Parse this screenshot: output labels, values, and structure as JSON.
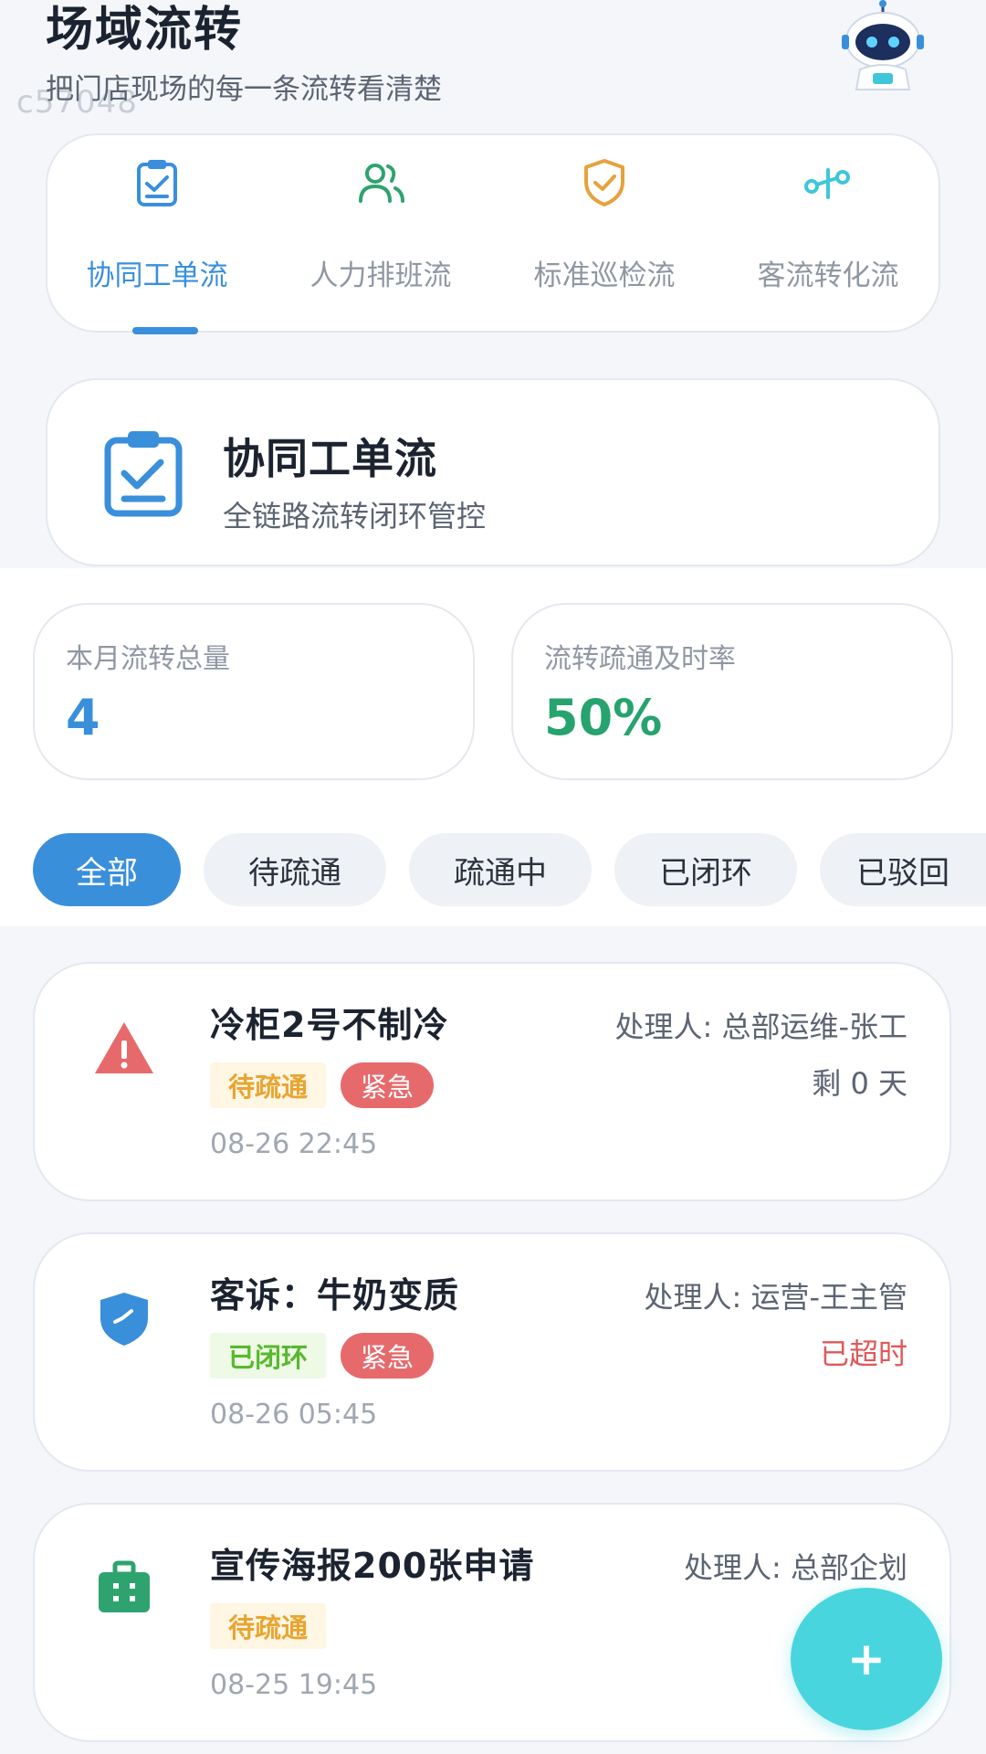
{
  "watermark": "c57048",
  "header": {
    "title": "场域流转",
    "subtitle": "把门店现场的每一条流转看清楚"
  },
  "flow_tabs": [
    {
      "label": "协同工单流",
      "icon": "clipboard-check-icon",
      "active": true
    },
    {
      "label": "人力排班流",
      "icon": "people-icon",
      "active": false
    },
    {
      "label": "标准巡检流",
      "icon": "shield-check-icon",
      "active": false
    },
    {
      "label": "客流转化流",
      "icon": "flow-nodes-icon",
      "active": false
    }
  ],
  "current_flow": {
    "title": "协同工单流",
    "subtitle": "全链路流转闭环管控",
    "icon": "clipboard-check-icon"
  },
  "stats": {
    "total": {
      "label": "本月流转总量",
      "value": "4",
      "color": "#3a8fdb"
    },
    "rate": {
      "label": "流转疏通及时率",
      "value": "50%",
      "color": "#27a36f"
    }
  },
  "filters": [
    {
      "label": "全部",
      "active": true
    },
    {
      "label": "待疏通",
      "active": false
    },
    {
      "label": "疏通中",
      "active": false
    },
    {
      "label": "已闭环",
      "active": false
    },
    {
      "label": "已驳回",
      "active": false
    }
  ],
  "tickets": [
    {
      "title": "冷柜2号不制冷",
      "icon": "warning-triangle-icon",
      "status": "待疏通",
      "priority": "紧急",
      "time": "08-26 22:45",
      "handler": "处理人: 总部运维-张工",
      "remain": "剩 0 天"
    },
    {
      "title": "客诉：牛奶变质",
      "icon": "shield-badge-icon",
      "status": "已闭环",
      "priority": "紧急",
      "time": "08-26 05:45",
      "handler": "处理人: 运营-王主管",
      "remain": "已超时"
    },
    {
      "title": "宣传海报200张申请",
      "icon": "briefcase-icon",
      "status": "待疏通",
      "time": "08-25 19:45",
      "handler": "处理人: 总部企划"
    }
  ],
  "fab": {
    "label": "+"
  }
}
